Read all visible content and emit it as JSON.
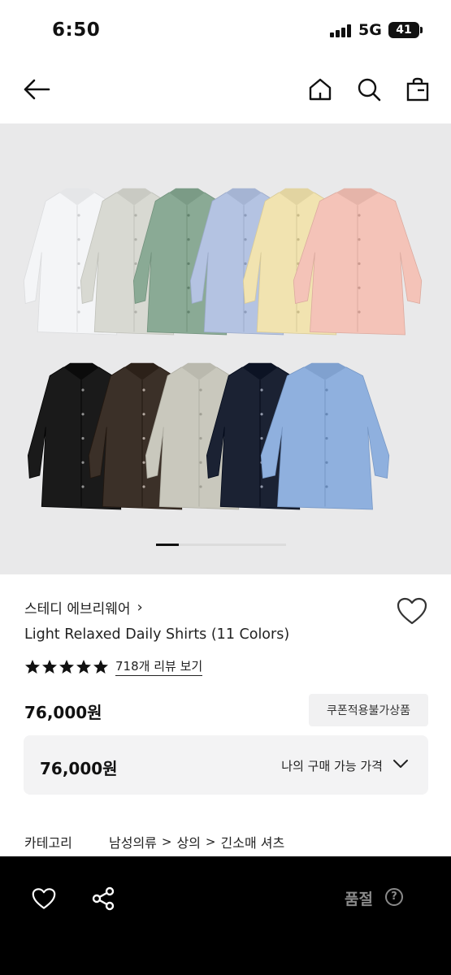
{
  "status_bar": {
    "time": "6:50",
    "network": "5G",
    "battery": "41"
  },
  "nav": {
    "icons": [
      "back-arrow-icon",
      "home-icon",
      "search-icon",
      "shopping-bag-icon"
    ]
  },
  "gallery": {
    "top_row_colors": [
      "#f4f5f7",
      "#d8d9d2",
      "#8aaa95",
      "#b4c3e2",
      "#f1e3b0",
      "#f4c3b8"
    ],
    "bottom_row_colors": [
      "#1a1a1a",
      "#3b3028",
      "#c9c8bd",
      "#1b2233",
      "#8fb0de"
    ],
    "background": "#e9e9ea"
  },
  "product": {
    "brand": "스테디 에브리웨어",
    "brand_chevron": "›",
    "title": "Light Relaxed Daily Shirts (11 Colors)",
    "rating_stars": 5,
    "review_link": "718개 리뷰 보기",
    "price": "76,000원",
    "coupon_badge": "쿠폰적용불가상품",
    "my_price": {
      "value": "76,000원",
      "label": "나의 구매 가능 가격"
    },
    "category": {
      "label": "카테고리",
      "path": [
        "남성의류",
        "상의",
        "긴소매 셔츠"
      ],
      "separator": ">"
    }
  },
  "bottom_bar": {
    "sold_out_label": "품절",
    "help_glyph": "?"
  },
  "colors": {
    "accent": "#000000",
    "text": "#111111",
    "muted": "#8a8a8a"
  }
}
